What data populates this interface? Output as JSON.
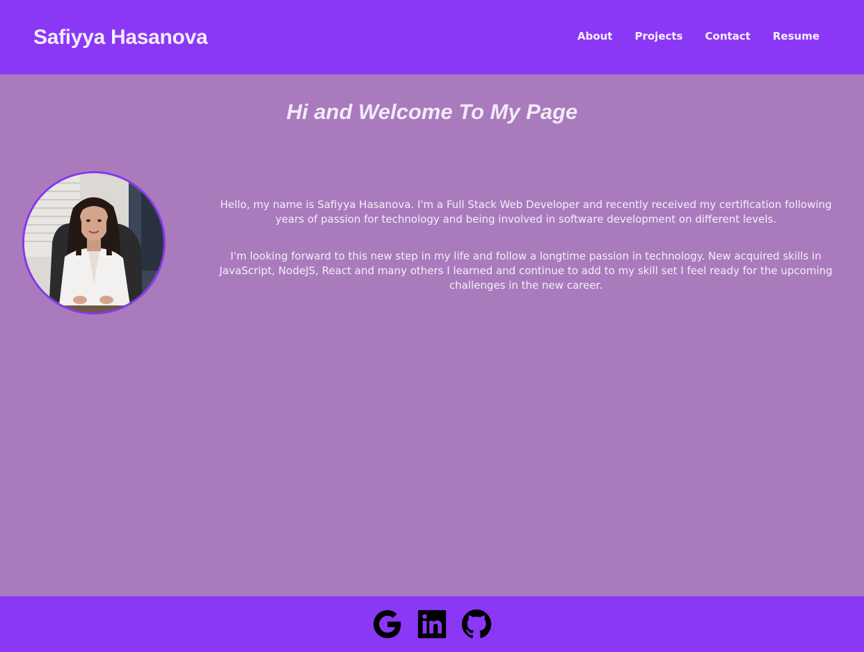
{
  "header": {
    "title": "Safiyya Hasanova",
    "nav": [
      {
        "label": "About"
      },
      {
        "label": "Projects"
      },
      {
        "label": "Contact"
      },
      {
        "label": "Resume"
      }
    ]
  },
  "main": {
    "heading": "Hi and Welcome To My Page",
    "bio": [
      "Hello, my name is Safiyya Hasanova. I'm a Full Stack Web Developer and recently received my certification following years of passion for technology and being involved in software development on different levels.",
      "I'm looking forward to this new step in my life and follow a longtime passion in technology. New acquired skills in JavaScript, NodeJS, React and many others I learned and continue to add to my skill set I feel ready for the upcoming challenges in the new career."
    ]
  },
  "footer": {
    "social_icons": [
      "google-icon",
      "linkedin-icon",
      "github-icon"
    ]
  },
  "colors": {
    "header_bg": "#8a38f5",
    "page_bg": "#a97bbd",
    "avatar_border": "#8438ee",
    "text": "#f4ecfa"
  }
}
